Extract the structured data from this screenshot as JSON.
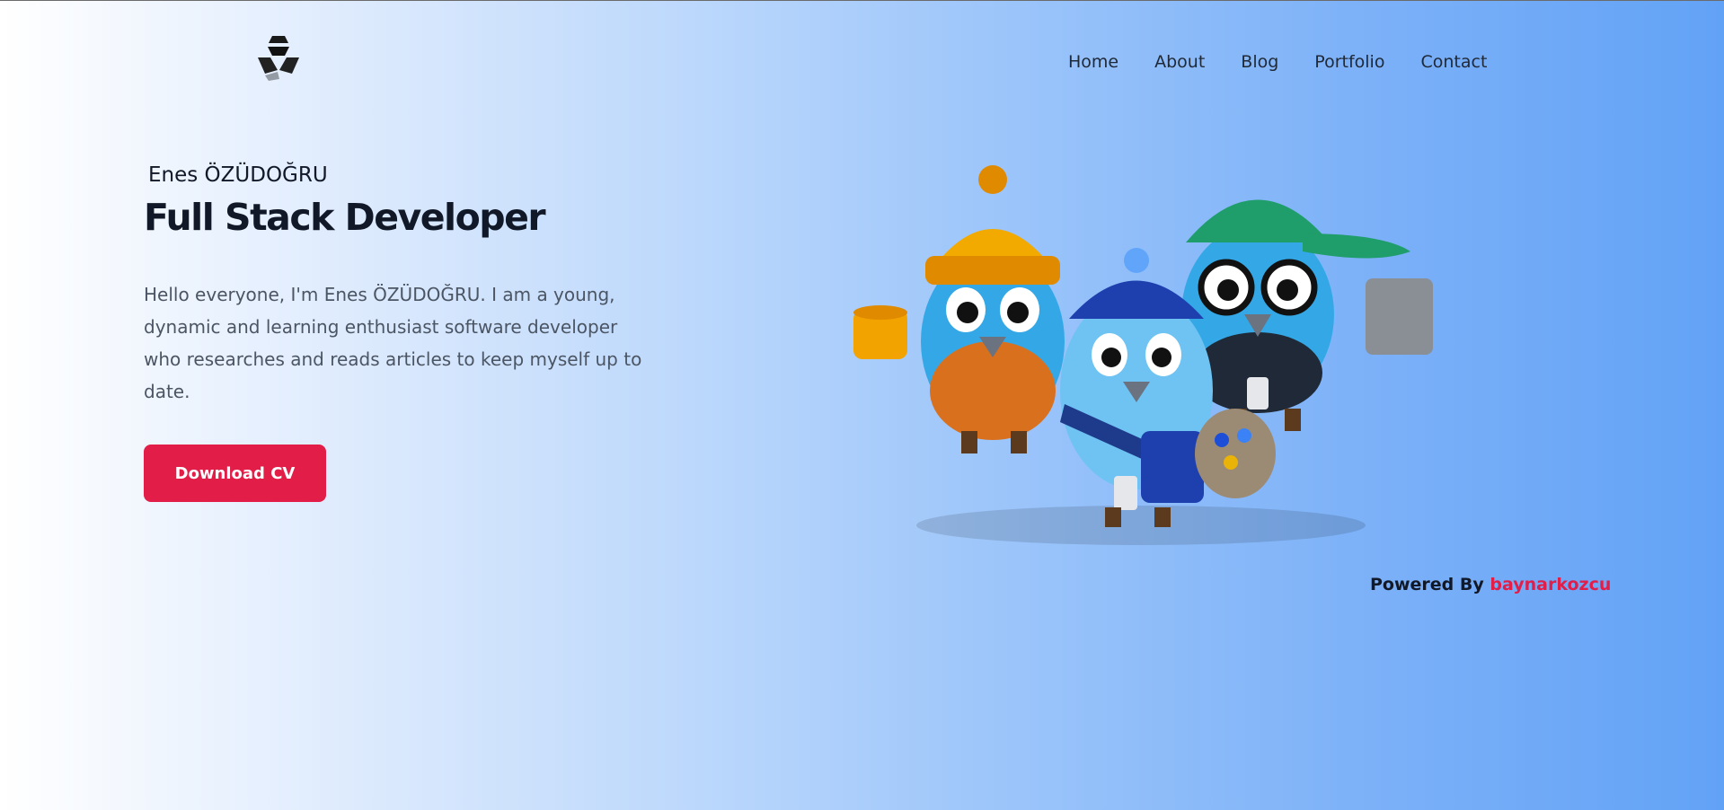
{
  "nav": {
    "items": [
      "Home",
      "About",
      "Blog",
      "Portfolio",
      "Contact"
    ]
  },
  "hero": {
    "name": "Enes ÖZÜDOĞRU",
    "title": "Full Stack Developer",
    "description": "Hello everyone, I'm Enes ÖZÜDOĞRU. I am a young, dynamic and learning enthusiast software developer who researches and reads articles to keep myself up to date.",
    "cta_label": "Download CV"
  },
  "footer": {
    "powered_prefix": "Powered By",
    "powered_author": "baynarkozcu"
  },
  "colors": {
    "accent": "#e11d48",
    "text_dark": "#111827",
    "text_muted": "#4b5563",
    "bg_start": "#ffffff",
    "bg_end": "#62a2f6"
  },
  "icons": {
    "logo": "geometric-logo-icon",
    "hero_art": "cartoon-birds-illustration"
  }
}
